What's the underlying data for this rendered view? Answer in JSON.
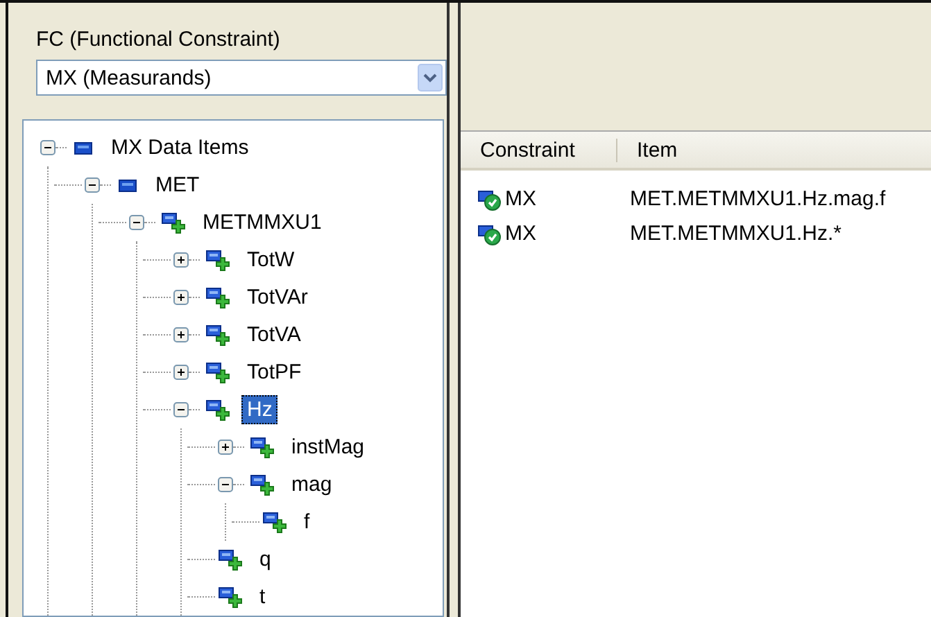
{
  "filter": {
    "label": "FC (Functional Constraint)",
    "value": "MX (Measurands)"
  },
  "tree": [
    {
      "label": "MX Data Items",
      "kind": "group",
      "expanded": true,
      "selected": false,
      "children": [
        {
          "label": "MET",
          "kind": "group",
          "expanded": true,
          "selected": false,
          "children": [
            {
              "label": "METMMXU1",
              "kind": "node",
              "expanded": true,
              "selected": false,
              "children": [
                {
                  "label": "TotW",
                  "kind": "node",
                  "expanded": false,
                  "selected": false
                },
                {
                  "label": "TotVAr",
                  "kind": "node",
                  "expanded": false,
                  "selected": false
                },
                {
                  "label": "TotVA",
                  "kind": "node",
                  "expanded": false,
                  "selected": false
                },
                {
                  "label": "TotPF",
                  "kind": "node",
                  "expanded": false,
                  "selected": false
                },
                {
                  "label": "Hz",
                  "kind": "node",
                  "expanded": true,
                  "selected": true,
                  "children": [
                    {
                      "label": "instMag",
                      "kind": "node",
                      "expanded": false,
                      "selected": false
                    },
                    {
                      "label": "mag",
                      "kind": "node",
                      "expanded": true,
                      "selected": false,
                      "children": [
                        {
                          "label": "f",
                          "kind": "node",
                          "selected": false
                        }
                      ]
                    },
                    {
                      "label": "q",
                      "kind": "node",
                      "selected": false
                    },
                    {
                      "label": "t",
                      "kind": "node",
                      "selected": false
                    }
                  ]
                }
              ]
            }
          ]
        }
      ]
    }
  ],
  "list": {
    "columns": [
      "Constraint",
      "Item"
    ],
    "rows": [
      {
        "constraint": "MX",
        "item": "MET.METMMXU1.Hz.mag.f"
      },
      {
        "constraint": "MX",
        "item": "MET.METMMXU1.Hz.*"
      }
    ]
  }
}
